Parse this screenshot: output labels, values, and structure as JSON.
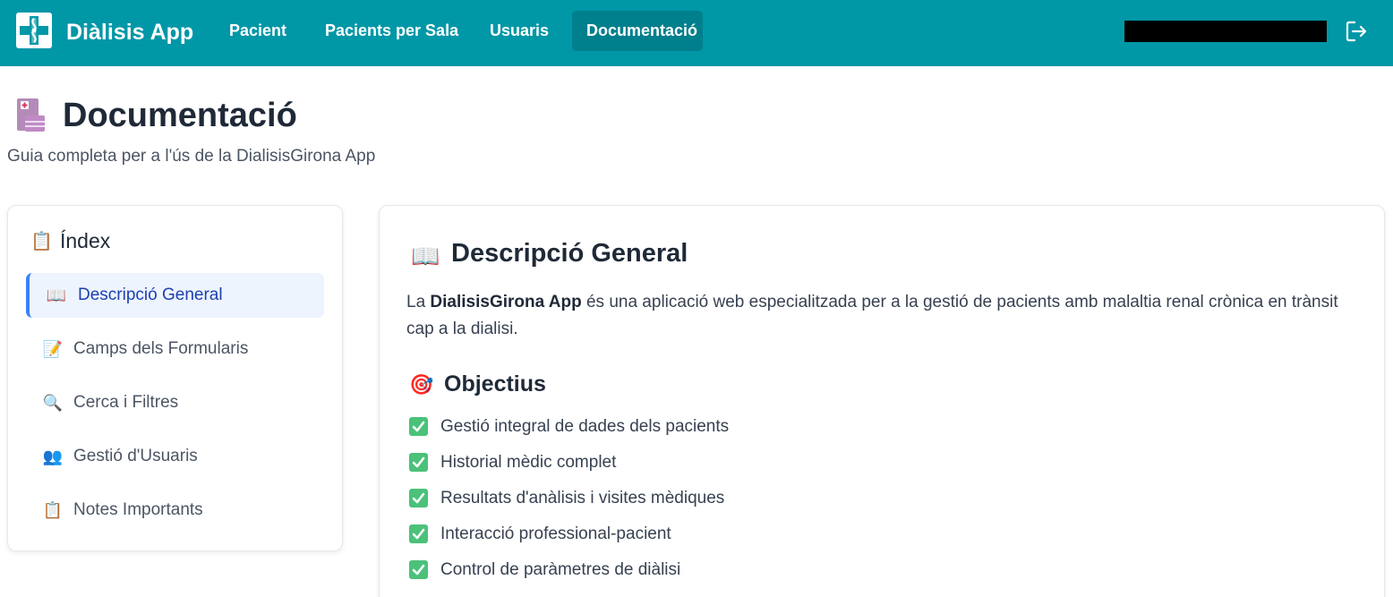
{
  "app": {
    "name": "Diàlisis App"
  },
  "nav": {
    "items": [
      {
        "label": "Pacient"
      },
      {
        "label": "Pacients per Sala"
      },
      {
        "label": "Usuaris"
      },
      {
        "label": "Documentació",
        "active": true
      }
    ]
  },
  "page": {
    "title": "Documentació",
    "subtitle": "Guia completa per a l'ús de la DialisisGirona App",
    "icon": "hospital-book-icon"
  },
  "index": {
    "title": "Índex",
    "title_icon": "clipboard-icon",
    "items": [
      {
        "label": "Descripció General",
        "icon": "open-book-icon",
        "glyph": "📖",
        "active": true
      },
      {
        "label": "Camps dels Formularis",
        "icon": "memo-icon",
        "glyph": "📝"
      },
      {
        "label": "Cerca i Filtres",
        "icon": "magnifier-icon",
        "glyph": "🔍"
      },
      {
        "label": "Gestió d'Usuaris",
        "icon": "users-icon",
        "glyph": "👥"
      },
      {
        "label": "Notes Importants",
        "icon": "clipboard-icon",
        "glyph": "📋"
      }
    ]
  },
  "content": {
    "section_title": "Descripció General",
    "section_icon": "open-book-icon",
    "description_prefix": "La ",
    "description_app": "DialisisGirona App",
    "description_rest": " és una aplicació web especialitzada per a la gestió de pacients amb malaltia renal crònica en trànsit cap a la dialisi.",
    "objectives_title": "Objectius",
    "objectives_icon": "target-icon",
    "objectives": [
      "Gestió integral de dades dels pacients",
      "Historial mèdic complet",
      "Resultats d'anàlisis i visites mèdiques",
      "Interacció professional-pacient",
      "Control de paràmetres de diàlisi"
    ]
  },
  "colors": {
    "navbar": "#0097a7",
    "nav_active": "#007f8c",
    "index_active_bg": "#edf4fe",
    "index_active_border": "#3b82f6",
    "index_active_text": "#1e40af",
    "check": "#4bc17a"
  }
}
